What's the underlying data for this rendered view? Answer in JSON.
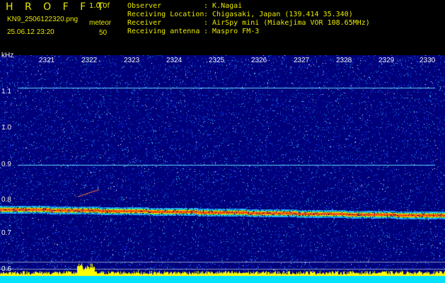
{
  "header": {
    "brand": "H R O F F T",
    "version": "1.0.0f",
    "filename": "KN9_2506122320.png",
    "mode": "meteor",
    "datetime": "25.06.12 23:20",
    "count": "50"
  },
  "info": {
    "observer_label": "Observer",
    "observer_value": ": K.Nagai",
    "location_label": "Receiving Location",
    "location_value": ": Chigasaki, Japan (139.414 35.340)",
    "receiver_label": "Receiver",
    "receiver_value": ": AirSpy mini (Miakejima VOR 108.65MHz)",
    "antenna_label": "Receiving antenna",
    "antenna_value": ": Maspro FM-3"
  },
  "axes": {
    "unit": "kHz",
    "y_ticks": [
      "1.1",
      "1.0",
      "0.9",
      "0.8",
      "0.7",
      "0.6"
    ],
    "x_ticks": [
      "2321",
      "2322",
      "2323",
      "2324",
      "2325",
      "2326",
      "2327",
      "2328",
      "2329",
      "2330"
    ]
  },
  "colors": {
    "background": "#00007a",
    "header_text": "#e8e800",
    "axis_text": "#f0f0f0",
    "signal_band": "#ff9000",
    "baseline": "#00e0ff"
  }
}
